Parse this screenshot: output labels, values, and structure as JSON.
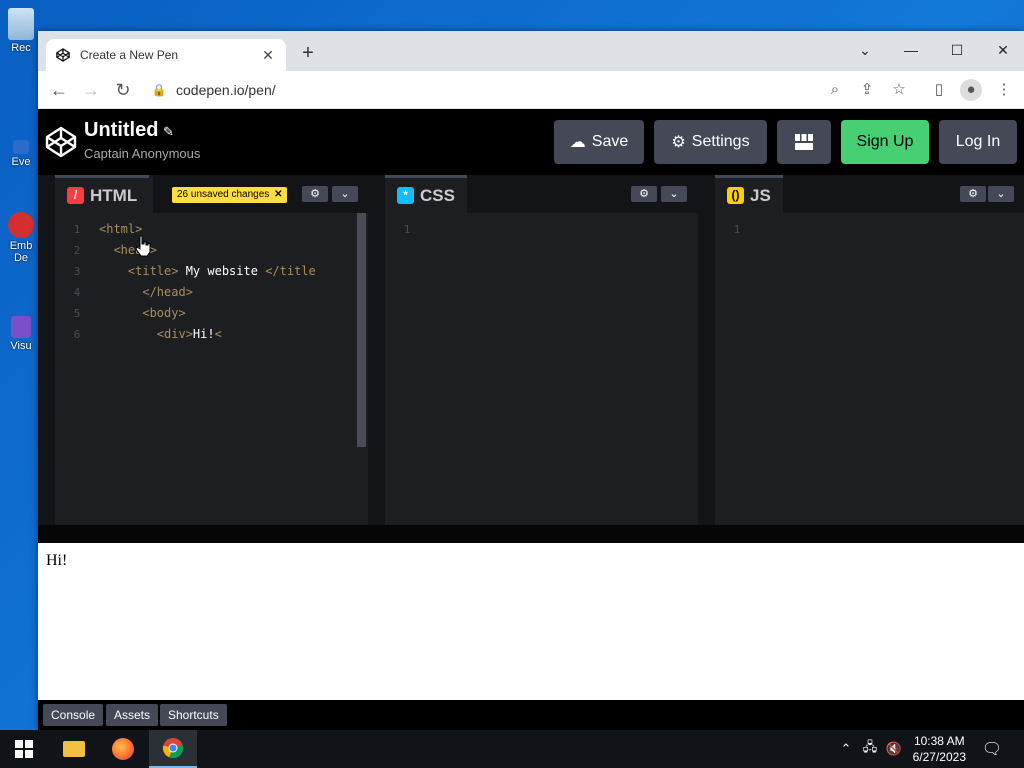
{
  "desktop": {
    "icons": [
      {
        "label": "Rec",
        "icon": "recycle-bin-icon"
      },
      {
        "label": "Eve",
        "icon": "shortcut-icon"
      },
      {
        "label": "Emb",
        "sublabel": "De",
        "icon": "shortcut-icon"
      },
      {
        "label": "Visu",
        "icon": "shortcut-icon"
      }
    ]
  },
  "browser": {
    "tab": {
      "title": "Create a New Pen",
      "favicon": "codepen-icon"
    },
    "url": "codepen.io/pen/"
  },
  "codepen": {
    "pen_title": "Untitled",
    "author": "Captain Anonymous",
    "buttons": {
      "save": "Save",
      "settings": "Settings",
      "signup": "Sign Up",
      "login": "Log In"
    },
    "panes": {
      "html": {
        "label": "HTML",
        "badge": "26 unsaved changes"
      },
      "css": {
        "label": "CSS"
      },
      "js": {
        "label": "JS"
      }
    },
    "html_code": [
      {
        "n": "1",
        "segments": [
          {
            "t": "<html>",
            "c": "tag"
          }
        ]
      },
      {
        "n": "2",
        "segments": [
          {
            "t": "  <head>",
            "c": "tag"
          }
        ]
      },
      {
        "n": "3",
        "segments": [
          {
            "t": "    <title>",
            "c": "tag"
          },
          {
            "t": " My website ",
            "c": "txt"
          },
          {
            "t": "</title",
            "c": "tag"
          }
        ]
      },
      {
        "n": "4",
        "segments": [
          {
            "t": "      </head>",
            "c": "tag"
          }
        ]
      },
      {
        "n": "5",
        "segments": [
          {
            "t": "      <body>",
            "c": "tag"
          }
        ]
      },
      {
        "n": "6",
        "segments": [
          {
            "t": "        <div>",
            "c": "tag"
          },
          {
            "t": "Hi!",
            "c": "txt"
          },
          {
            "t": "<",
            "c": "tag"
          }
        ]
      }
    ],
    "css_line": "1",
    "js_line": "1",
    "preview_text": "Hi!",
    "footer": {
      "console": "Console",
      "assets": "Assets",
      "shortcuts": "Shortcuts"
    }
  },
  "taskbar": {
    "time": "10:38 AM",
    "date": "6/27/2023"
  },
  "colors": {
    "html_icon": "#ff3c41",
    "css_icon": "#0ebeff",
    "js_icon": "#fcd000",
    "signup": "#47cf73",
    "badge": "#ffdd40"
  }
}
